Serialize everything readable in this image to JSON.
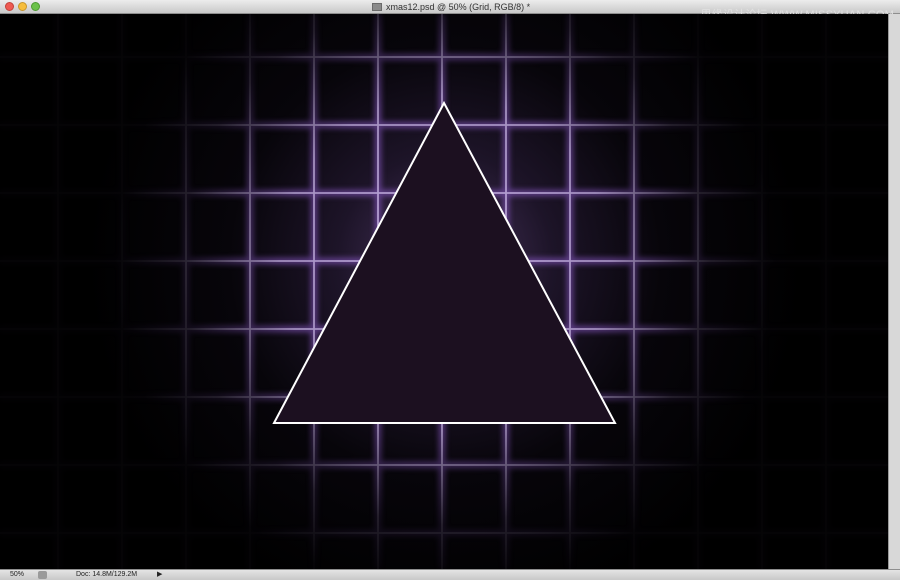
{
  "window": {
    "title": "xmas12.psd @ 50% (Grid, RGB/8) *",
    "watermark": "思缘设计论坛 WWW.MISSYUAN.COM"
  },
  "status": {
    "zoom": "50%",
    "doc_info": "Doc: 14.8M/129.2M",
    "arrow_icon": "triangle-right-icon"
  },
  "colors": {
    "background": "#000000",
    "grid_glow": "#9b7fc0",
    "triangle_fill": "#1c1020",
    "triangle_stroke": "#ffffff"
  }
}
